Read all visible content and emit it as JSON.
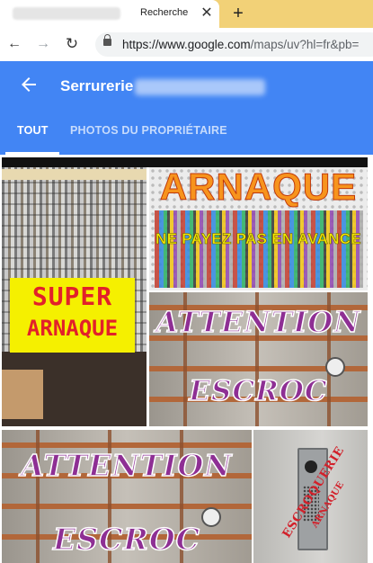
{
  "browser": {
    "tab_title": "Recherche",
    "tab_close": "✕",
    "new_tab": "+",
    "back": "←",
    "forward": "→",
    "reload": "↻",
    "url_host": "https://www.google.com",
    "url_path": "/maps/uv?hl=fr&pb="
  },
  "maps": {
    "back_icon": "arrow-left",
    "place_title": "Serrurerie",
    "tabs": [
      {
        "label": "TOUT",
        "active": true
      },
      {
        "label": "PHOTOS DU PROPRIÉTAIRE",
        "active": false
      }
    ],
    "accent_color": "#4285f4"
  },
  "photos": {
    "p1": {
      "line1": "SUPER",
      "line2": "ARNAQUE"
    },
    "p2": {
      "line1": "ARNAQUE",
      "line2": "NE PAYEZ PAS EN AVANCE"
    },
    "p3": {
      "line1": "ATTENTION",
      "line2": "ESCROC"
    },
    "p4": {
      "line1": "ATTENTION",
      "line2": "ESCROC"
    },
    "p5": {
      "line1": "ESCROQUERIE",
      "line2": "ARNAQUE"
    }
  }
}
